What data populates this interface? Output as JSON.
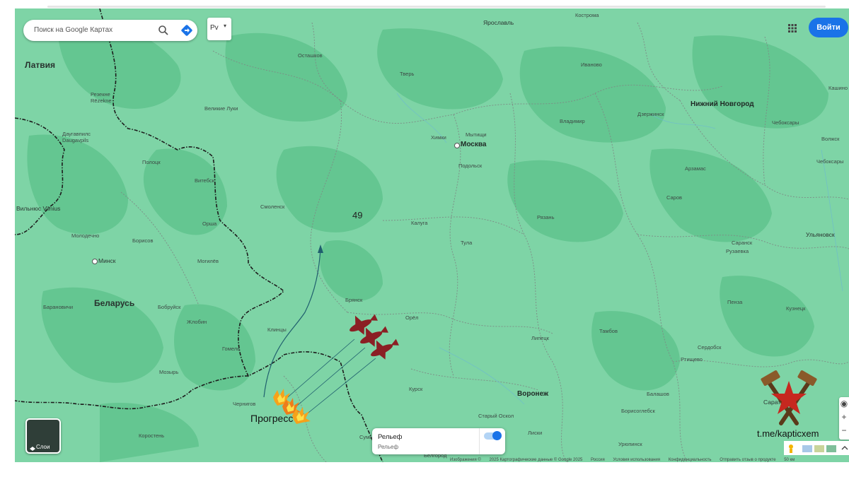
{
  "search": {
    "placeholder": "Поиск на Google Картах"
  },
  "layer_select": {
    "label": "Рv"
  },
  "header": {
    "login_label": "Войти"
  },
  "layers_button": {
    "label": "Слои"
  },
  "relief_panel": {
    "title": "Рельеф",
    "subtitle": "Рельеф",
    "enabled": true
  },
  "footer": {
    "items": [
      "Изображения ©",
      "2025 Картографические данные © Google 2025",
      "Россия",
      "Условия использования",
      "Конфиденциальность",
      "Отправить отзыв о продукте",
      "50 км"
    ]
  },
  "overlay": {
    "label_49": "49",
    "impact_label": "Прогресс",
    "watermark": "t.me/kapticxem"
  },
  "map": {
    "countries": [
      {
        "name": "Латвия"
      },
      {
        "name": "Беларусь"
      }
    ],
    "cities_large": [
      "Москва",
      "Нижний Новгород",
      "Воронеж"
    ],
    "cities_medium": [
      "Ярославль",
      "Вильнюс Vilnius",
      "Минск",
      "Ульяновск"
    ],
    "cities_small": [
      "Осташков",
      "Тверь",
      "Иваново",
      "Кострома",
      "Великие Луки",
      "Резекне Rēzekne",
      "Химки",
      "Мытищи",
      "Дзержинск",
      "Владимир",
      "Даугавпилс Daugavpils",
      "Подольск",
      "Полоцк",
      "Витебск",
      "Арзамас",
      "Смоленск",
      "Калуга",
      "Саров",
      "Рязань",
      "Орша",
      "Молодечно",
      "Борисов",
      "Тула",
      "Саранск",
      "Рузаевка",
      "Могилёв",
      "Брянск",
      "Пенза",
      "Барановичи",
      "Бобруйск",
      "Орёл",
      "Кузнецк",
      "Жлобин",
      "Клинцы",
      "Тамбов",
      "Липецк",
      "Гомель",
      "Сердобск",
      "Мозырь",
      "Ртищево",
      "Курск",
      "Чернигов",
      "Старый Оскол",
      "Борисоглебск",
      "Балашов",
      "Коростень",
      "Сумы",
      "Лиски",
      "Урюпинск",
      "Белгород",
      "Чебоксары",
      "Волжск",
      "Чебоксары",
      "Кашино",
      "Саратов"
    ],
    "colors": {
      "land": "#7ed4a6",
      "forest": "#5cc28a",
      "border": "#1c1c1c",
      "region_border": "#7d8b85",
      "drone": "#8b1f24",
      "arrow": "#1f5f6e"
    }
  }
}
